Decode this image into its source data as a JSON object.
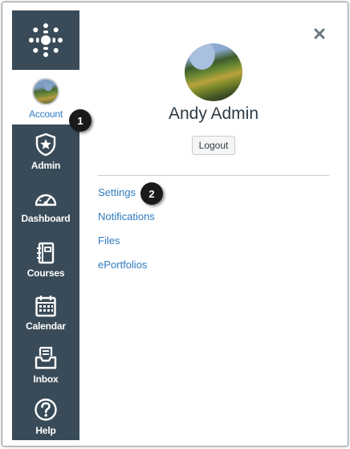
{
  "sidebar": {
    "logo": {
      "icon": "canvas-logo-icon"
    },
    "items": [
      {
        "id": "account",
        "label": "Account",
        "icon": "user-avatar",
        "active": true
      },
      {
        "id": "admin",
        "label": "Admin",
        "icon": "shield-star-icon"
      },
      {
        "id": "dashboard",
        "label": "Dashboard",
        "icon": "speedometer-icon"
      },
      {
        "id": "courses",
        "label": "Courses",
        "icon": "book-icon"
      },
      {
        "id": "calendar",
        "label": "Calendar",
        "icon": "calendar-icon"
      },
      {
        "id": "inbox",
        "label": "Inbox",
        "icon": "inbox-icon"
      },
      {
        "id": "help",
        "label": "Help",
        "icon": "question-circle-icon"
      }
    ]
  },
  "tray": {
    "close_icon": "close-icon",
    "user_name": "Andy Admin",
    "logout_label": "Logout",
    "links": [
      {
        "label": "Settings"
      },
      {
        "label": "Notifications"
      },
      {
        "label": "Files"
      },
      {
        "label": "ePortfolios"
      }
    ]
  },
  "callouts": [
    {
      "number": "1"
    },
    {
      "number": "2"
    }
  ],
  "colors": {
    "sidebar_bg": "#394b58",
    "link": "#2d7bbf",
    "text": "#2d3b45",
    "badge_bg": "#1a1a1a"
  }
}
